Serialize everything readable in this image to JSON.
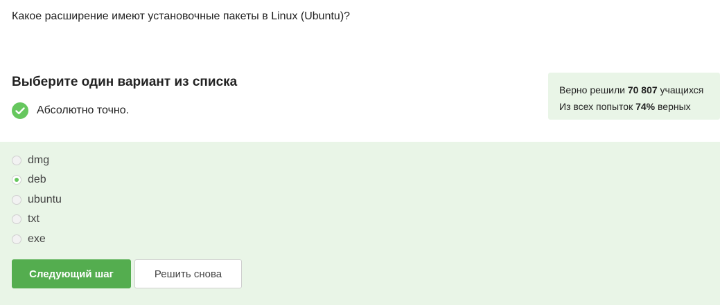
{
  "question": {
    "text": "Какое расширение имеют установочные пакеты в Linux (Ubuntu)?"
  },
  "section": {
    "title": "Выберите один вариант из списка"
  },
  "feedback": {
    "icon": "check-circle-icon",
    "text": "Абсолютно точно."
  },
  "stats": {
    "solved_prefix": "Верно решили ",
    "solved_count": "70 807",
    "solved_suffix": " учащихся",
    "attempts_prefix": "Из всех попыток ",
    "attempts_percent": "74%",
    "attempts_suffix": " верных"
  },
  "options": [
    {
      "label": "dmg",
      "selected": false
    },
    {
      "label": "deb",
      "selected": true
    },
    {
      "label": "ubuntu",
      "selected": false
    },
    {
      "label": "txt",
      "selected": false
    },
    {
      "label": "exe",
      "selected": false
    }
  ],
  "buttons": {
    "next_label": "Следующий шаг",
    "retry_label": "Решить снова"
  },
  "colors": {
    "accent_green": "#54ad4f",
    "check_green": "#66c75e",
    "panel_bg": "#e9f5e7"
  }
}
